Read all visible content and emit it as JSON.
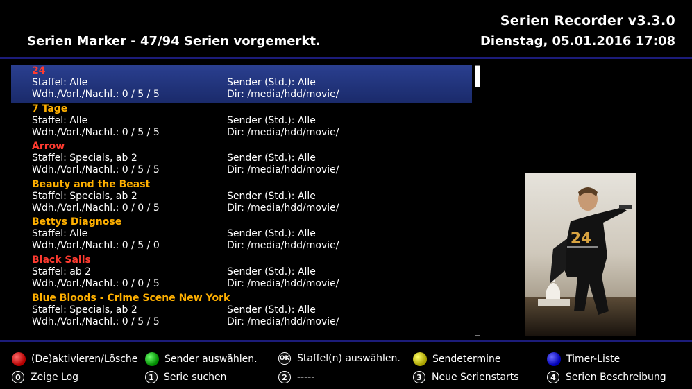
{
  "header": {
    "app_title": "Serien Recorder v3.3.0",
    "page_title": "Serien Marker - 47/94 Serien vorgemerkt.",
    "datetime": "Dienstag, 05.01.2016  17:08"
  },
  "series": [
    {
      "title": "24",
      "title_color": "#ff3b30",
      "staffel": "Staffel: Alle",
      "sender": "Sender (Std.): Alle",
      "wdh": "Wdh./Vorl./Nachl.: 0 / 5 / 5",
      "dir": "Dir: /media/hdd/movie/"
    },
    {
      "title": "7 Tage",
      "title_color": "#ffb000",
      "staffel": "Staffel: Alle",
      "sender": "Sender (Std.): Alle",
      "wdh": "Wdh./Vorl./Nachl.: 0 / 5 / 5",
      "dir": "Dir: /media/hdd/movie/"
    },
    {
      "title": "Arrow",
      "title_color": "#ff3b30",
      "staffel": "Staffel: Specials, ab 2",
      "sender": "Sender (Std.): Alle",
      "wdh": "Wdh./Vorl./Nachl.: 0 / 5 / 5",
      "dir": "Dir: /media/hdd/movie/"
    },
    {
      "title": "Beauty and the Beast",
      "title_color": "#ffb000",
      "staffel": "Staffel: Specials, ab 2",
      "sender": "Sender (Std.): Alle",
      "wdh": "Wdh./Vorl./Nachl.: 0 / 0 / 5",
      "dir": "Dir: /media/hdd/movie/"
    },
    {
      "title": "Bettys Diagnose",
      "title_color": "#ffb000",
      "staffel": "Staffel: Alle",
      "sender": "Sender (Std.): Alle",
      "wdh": "Wdh./Vorl./Nachl.: 0 / 5 / 0",
      "dir": "Dir: /media/hdd/movie/"
    },
    {
      "title": "Black Sails",
      "title_color": "#ff3b30",
      "staffel": "Staffel: ab 2",
      "sender": "Sender (Std.): Alle",
      "wdh": "Wdh./Vorl./Nachl.: 0 / 0 / 5",
      "dir": "Dir: /media/hdd/movie/"
    },
    {
      "title": "Blue Bloods - Crime Scene New York",
      "title_color": "#ffb000",
      "staffel": "Staffel: Specials, ab 2",
      "sender": "Sender (Std.): Alle",
      "wdh": "Wdh./Vorl./Nachl.: 0 / 5 / 5",
      "dir": "Dir: /media/hdd/movie/"
    }
  ],
  "selected_index": 0,
  "poster": {
    "label": "24"
  },
  "footer": {
    "row1": [
      {
        "icon": "red",
        "label": "(De)aktivieren/Lösche"
      },
      {
        "icon": "green",
        "label": "Sender auswählen."
      },
      {
        "icon": "ok",
        "key": "OK",
        "label": "Staffel(n) auswählen."
      },
      {
        "icon": "yellow",
        "label": "Sendetermine"
      },
      {
        "icon": "blue",
        "label": "Timer-Liste"
      }
    ],
    "row2": [
      {
        "key": "0",
        "label": "Zeige Log"
      },
      {
        "key": "1",
        "label": "Serie suchen"
      },
      {
        "key": "2",
        "label": "-----"
      },
      {
        "key": "3",
        "label": "Neue Serienstarts"
      },
      {
        "key": "4",
        "label": "Serien Beschreibung"
      }
    ]
  },
  "colors": {
    "selection": "#23357c",
    "divider": "#1c1c7a"
  }
}
